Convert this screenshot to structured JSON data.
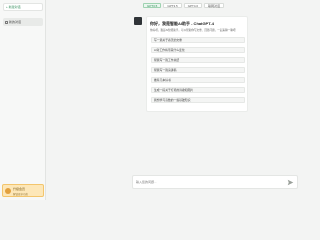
{
  "sidebar": {
    "new_chat_label": "+ 新建对话",
    "history": [
      {
        "label": "新的对话"
      }
    ],
    "login_card": {
      "line1": "升级会员",
      "line2": "解锁更多功能"
    }
  },
  "model_tabs": [
    {
      "label": "GPT3.5",
      "active": true
    },
    {
      "label": "GPT3.5"
    },
    {
      "label": "GPT4.0"
    },
    {
      "label": "联网对话"
    }
  ],
  "chat": {
    "title": "你好，我是智能AI助手 - ChatGPT-4",
    "subtitle": "你好呀，我是AI智能助手，可以帮助你写文章、回答问题，一起来聊一聊吧",
    "suggestions": [
      {
        "label": "写一篇关于春天的文章"
      },
      {
        "label": "AI对工作将带来什么变化"
      },
      {
        "label": "帮我写一篇工作总结"
      },
      {
        "label": "帮我写一篇演讲稿"
      },
      {
        "label": "推荐几本好书"
      },
      {
        "label": "生成一段关于灯塔的诗歌和图片"
      },
      {
        "label": "我想学习高数的一些基础知识"
      }
    ]
  },
  "input": {
    "placeholder": "输入您的问题..."
  },
  "colors": {
    "accent": "#2e8b57",
    "login_bg": "#fde7b8"
  }
}
